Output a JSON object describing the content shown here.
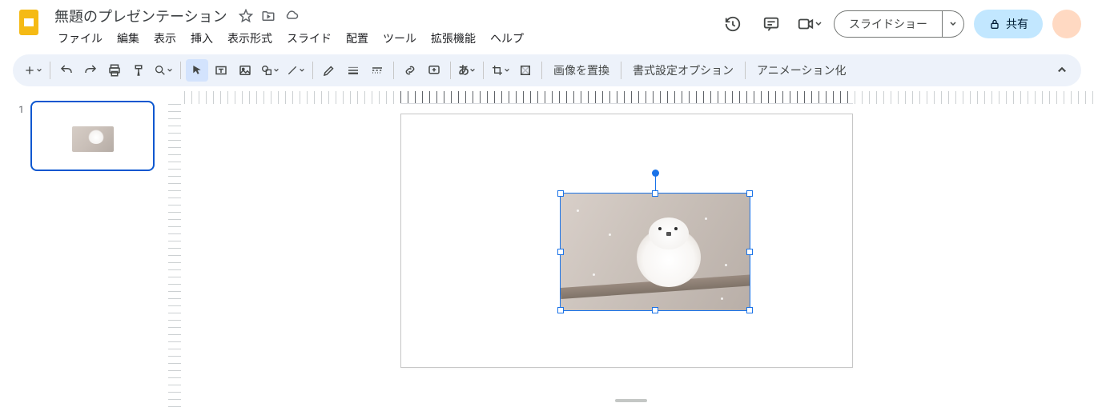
{
  "app": {
    "title": "無題のプレゼンテーション"
  },
  "menu": {
    "file": "ファイル",
    "edit": "編集",
    "view": "表示",
    "insert": "挿入",
    "format": "表示形式",
    "slide": "スライド",
    "arrange": "配置",
    "tools": "ツール",
    "extensions": "拡張機能",
    "help": "ヘルプ"
  },
  "header": {
    "slideshow": "スライドショー",
    "share": "共有"
  },
  "toolbar": {
    "replace_image": "画像を置換",
    "format_options": "書式設定オプション",
    "animate": "アニメーション化",
    "text_direction": "あ"
  },
  "filmstrip": {
    "slides": [
      {
        "num": "1"
      }
    ]
  },
  "icons": {
    "star": "star-icon",
    "folder_move": "folder-move-icon",
    "cloud": "cloud-saved-icon",
    "history": "history-icon",
    "comments": "comments-icon",
    "meet": "meet-icon",
    "lock": "lock-icon",
    "caret": "caret-down-icon"
  }
}
